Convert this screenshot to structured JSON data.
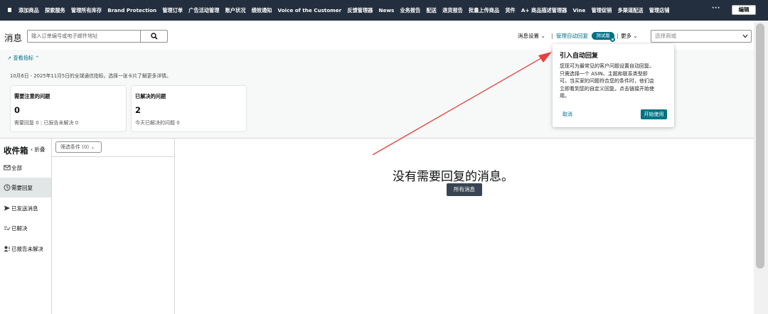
{
  "nav": {
    "items": [
      "添加商品",
      "探索服务",
      "管理所有库存",
      "Brand Protection",
      "管理订单",
      "广告活动管理",
      "账户状况",
      "绩效通知",
      "Voice of the Customer",
      "反馈管理器",
      "News",
      "业务报告",
      "配送",
      "退货报告",
      "批量上传商品",
      "货件",
      "A+ 商品描述管理器",
      "Vine",
      "管理促销",
      "多渠道配送",
      "管理店铺"
    ],
    "more": "···",
    "edit_label": "编辑"
  },
  "header": {
    "title": "消息",
    "search_placeholder": "输入订单编号或电子邮件地址",
    "message_settings": "消息设置",
    "separator": "|",
    "auto_reply": "管理自动回复",
    "beta_badge": "测试版",
    "more": "更多",
    "store_placeholder": "选择商城"
  },
  "metrics": {
    "toggle_label": "查看指标",
    "date_range": "10月6日 - 2025年11月5日的全球通信指标。选择一张卡片了解更多详情。",
    "cards": [
      {
        "title": "需要注意的问题",
        "value": "0",
        "sub_a": "需要回复 0",
        "sub_sep": "|",
        "sub_b": "已报告未解决 0"
      },
      {
        "title": "已解决的问题",
        "value": "2",
        "sub_a": "今天已解决的问题 0"
      }
    ]
  },
  "inbox": {
    "title": "收件箱",
    "collapse": "折叠",
    "filter_label": "筛选条件 (0)",
    "folders": [
      {
        "label": "全部",
        "icon": "mail-icon"
      },
      {
        "label": "需要回复",
        "icon": "clock-icon",
        "active": true
      },
      {
        "label": "已发送消息",
        "icon": "send-icon"
      },
      {
        "label": "已解决",
        "icon": "resolved-icon"
      },
      {
        "label": "已报告未解决",
        "icon": "report-icon"
      }
    ]
  },
  "main": {
    "empty_message": "没有需要回复的消息。",
    "all_messages_button": "所有消息"
  },
  "popover": {
    "title": "引入自动回复",
    "body_lines": [
      "您现可为最常见的客户问题设置自动回复。",
      "只需选择一个 ASIN、主题和联系类型即",
      "可。当买家的问题符合您的条件时，他们会",
      "立即看到您的自定义回复。点击链接开始使",
      "用。"
    ],
    "cancel": "取消",
    "start": "开始使用"
  },
  "colors": {
    "nav_bg": "#232f3e",
    "accent": "#007185",
    "annotation_arrow": "#e8403c",
    "button_dark": "#3a4553"
  }
}
